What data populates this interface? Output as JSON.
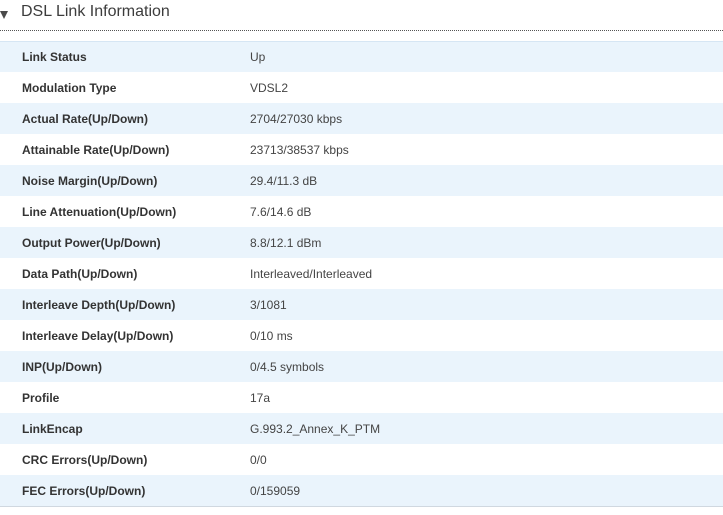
{
  "section": {
    "title": "DSL Link Information"
  },
  "rows": [
    {
      "label": "Link Status",
      "value": "Up"
    },
    {
      "label": "Modulation Type",
      "value": "VDSL2"
    },
    {
      "label": "Actual Rate(Up/Down)",
      "value": "2704/27030 kbps"
    },
    {
      "label": "Attainable Rate(Up/Down)",
      "value": "23713/38537 kbps"
    },
    {
      "label": "Noise Margin(Up/Down)",
      "value": "29.4/11.3 dB"
    },
    {
      "label": "Line Attenuation(Up/Down)",
      "value": "7.6/14.6 dB"
    },
    {
      "label": "Output Power(Up/Down)",
      "value": "8.8/12.1 dBm"
    },
    {
      "label": "Data Path(Up/Down)",
      "value": "Interleaved/Interleaved"
    },
    {
      "label": "Interleave Depth(Up/Down)",
      "value": "3/1081"
    },
    {
      "label": "Interleave Delay(Up/Down)",
      "value": "0/10 ms"
    },
    {
      "label": "INP(Up/Down)",
      "value": "0/4.5 symbols"
    },
    {
      "label": "Profile",
      "value": "17a"
    },
    {
      "label": "LinkEncap",
      "value": "G.993.2_Annex_K_PTM"
    },
    {
      "label": "CRC Errors(Up/Down)",
      "value": "0/0"
    },
    {
      "label": "FEC Errors(Up/Down)",
      "value": "0/159059"
    }
  ]
}
